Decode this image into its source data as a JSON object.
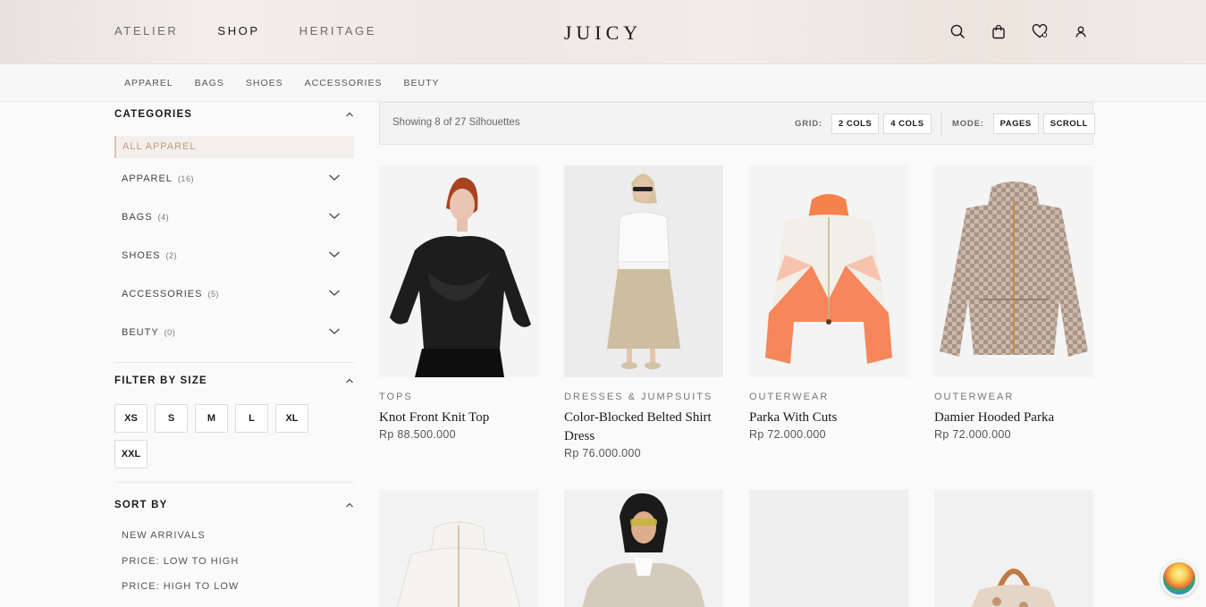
{
  "header": {
    "nav": [
      "ATELIER",
      "SHOP",
      "HERITAGE"
    ],
    "active_nav": "SHOP",
    "brand": "JUICY",
    "icons": [
      "search-icon",
      "bag-icon",
      "wishlist-heart-icon",
      "user-icon"
    ]
  },
  "subnav": [
    "APPAREL",
    "BAGS",
    "SHOES",
    "ACCESSORIES",
    "BEUTY"
  ],
  "sidebar": {
    "categories_title": "CATEGORIES",
    "all_label": "ALL APPAREL",
    "categories": [
      {
        "label": "APPAREL",
        "count": "(16)"
      },
      {
        "label": "BAGS",
        "count": "(4)"
      },
      {
        "label": "SHOES",
        "count": "(2)"
      },
      {
        "label": "ACCESSORIES",
        "count": "(5)"
      },
      {
        "label": "BEUTY",
        "count": "(0)"
      }
    ],
    "size_title": "FILTER BY SIZE",
    "sizes": [
      "XS",
      "S",
      "M",
      "L",
      "XL",
      "XXL"
    ],
    "sort_title": "SORT BY",
    "sort_options": [
      "NEW ARRIVALS",
      "PRICE: LOW TO HIGH",
      "PRICE: HIGH TO LOW"
    ]
  },
  "toolbar": {
    "showing": "Showing 8 of 27 Silhouettes",
    "grid_label": "GRID:",
    "grid_options": [
      "2 COLS",
      "4 COLS"
    ],
    "mode_label": "MODE:",
    "mode_options": [
      "PAGES",
      "SCROLL"
    ]
  },
  "products": [
    {
      "category": "TOPS",
      "name": "Knot Front Knit Top",
      "price": "Rp 88.500.000"
    },
    {
      "category": "DRESSES & JUMPSUITS",
      "name": "Color-Blocked Belted Shirt Dress",
      "price": "Rp 76.000.000"
    },
    {
      "category": "OUTERWEAR",
      "name": "Parka With Cuts",
      "price": "Rp 72.000.000"
    },
    {
      "category": "OUTERWEAR",
      "name": "Damier Hooded Parka",
      "price": "Rp 72.000.000"
    }
  ],
  "colors": {
    "accent": "#b59e85",
    "accent_bg": "#f4efea",
    "text": "#1a1a1a"
  }
}
